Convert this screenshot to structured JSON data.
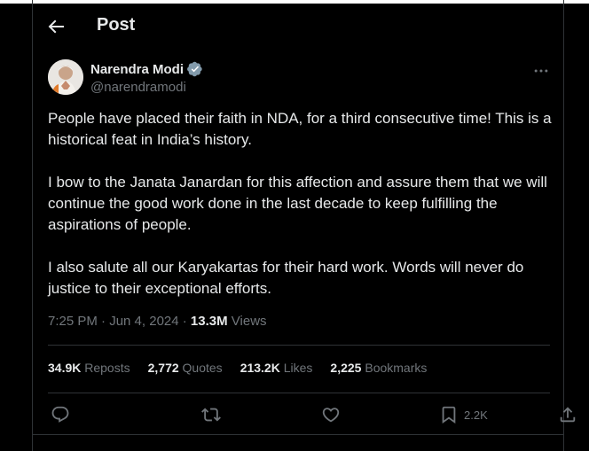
{
  "header": {
    "title": "Post"
  },
  "author": {
    "name": "Narendra Modi",
    "handle": "@narendramodi"
  },
  "post": {
    "paragraphs": [
      "People have placed their faith in NDA, for a third consecutive time! This is a historical feat in India’s history.",
      "I bow to the Janata Janardan for this affection and assure them that we will continue the good work done in the last decade to keep fulfilling the aspirations of people.",
      "I also salute all our Karyakartas for their hard work. Words will never do justice to their exceptional efforts."
    ],
    "timestamp": "7:25 PM · Jun 4, 2024 · ",
    "views_count": "13.3M",
    "views_label": " Views"
  },
  "stats": {
    "reposts_count": "34.9K",
    "reposts_label": " Reposts",
    "quotes_count": "2,772",
    "quotes_label": " Quotes",
    "likes_count": "213.2K",
    "likes_label": " Likes",
    "bookmarks_count": "2,225",
    "bookmarks_label": " Bookmarks"
  },
  "actions": {
    "bookmark_count": "2.2K"
  },
  "colors": {
    "background": "#000000",
    "text": "#e7e9ea",
    "muted": "#71767b",
    "verified": "#1d9bf0",
    "border": "#2f3336"
  },
  "icons": [
    "back-arrow-icon",
    "verified-badge-icon",
    "more-icon",
    "reply-icon",
    "repost-icon",
    "like-icon",
    "bookmark-icon",
    "share-icon"
  ]
}
